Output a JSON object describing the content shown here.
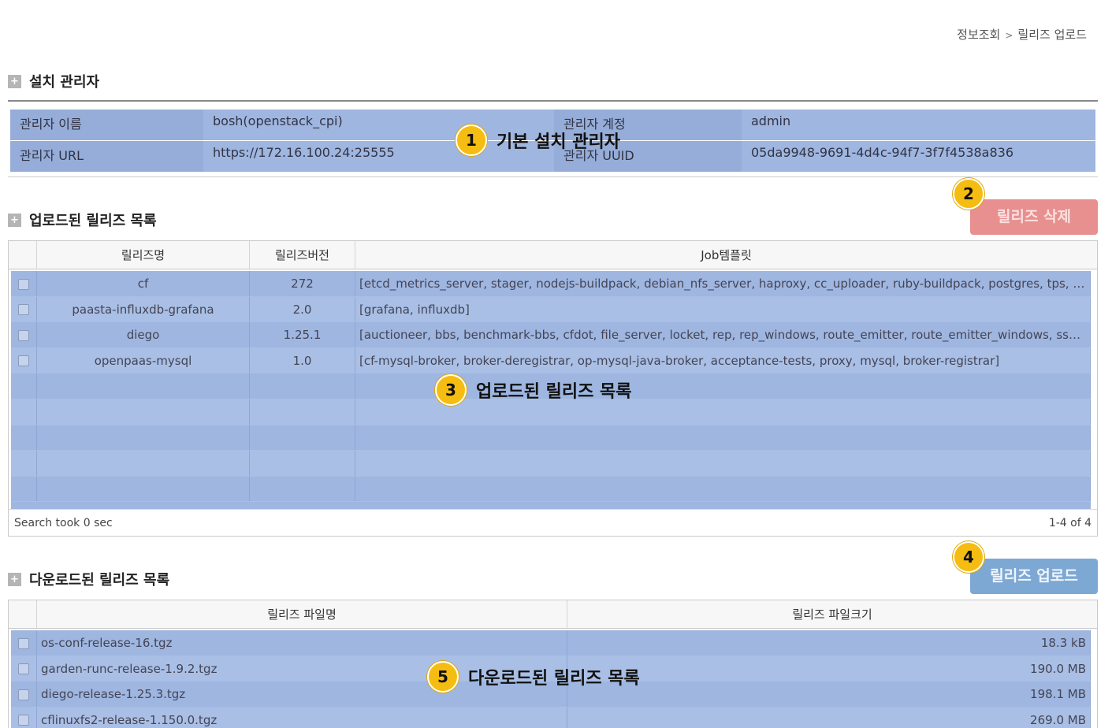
{
  "breadcrumb": {
    "parent": "정보조회",
    "separator": ">",
    "current": "릴리즈 업로드"
  },
  "installer": {
    "title": "설치 관리자",
    "name_label": "관리자 이름",
    "name_value": "bosh(openstack_cpi)",
    "account_label": "관리자 계정",
    "account_value": "admin",
    "url_label": "관리자 URL",
    "url_value": "https://172.16.100.24:25555",
    "uuid_label": "관리자 UUID",
    "uuid_value": "05da9948-9691-4d4c-94f7-3f7f4538a836"
  },
  "uploaded": {
    "title": "업로드된 릴리즈 목록",
    "delete_button": "릴리즈 삭제",
    "columns": [
      "릴리즈명",
      "릴리즈버전",
      "Job템플릿"
    ],
    "rows": [
      {
        "name": "cf",
        "version": "272",
        "jobs": "[etcd_metrics_server, stager, nodejs-buildpack, debian_nfs_server, haproxy, cc_uploader, ruby-buildpack, postgres, tps, nats, garden]"
      },
      {
        "name": "paasta-influxdb-grafana",
        "version": "2.0",
        "jobs": "[grafana, influxdb]"
      },
      {
        "name": "diego",
        "version": "1.25.1",
        "jobs": "[auctioneer, bbs, benchmark-bbs, cfdot, file_server, locket, rep, rep_windows, route_emitter, route_emitter_windows, ssh_proxy]"
      },
      {
        "name": "openpaas-mysql",
        "version": "1.0",
        "jobs": "[cf-mysql-broker, broker-deregistrar, op-mysql-java-broker, acceptance-tests, proxy, mysql, broker-registrar]"
      }
    ],
    "footer_left": "Search took 0 sec",
    "footer_right": "1-4 of 4"
  },
  "downloaded": {
    "title": "다운로드된 릴리즈 목록",
    "upload_button": "릴리즈 업로드",
    "columns": [
      "릴리즈 파일명",
      "릴리즈 파일크기"
    ],
    "rows": [
      {
        "file": "os-conf-release-16.tgz",
        "size": "18.3 kB"
      },
      {
        "file": "garden-runc-release-1.9.2.tgz",
        "size": "190.0 MB"
      },
      {
        "file": "diego-release-1.25.3.tgz",
        "size": "198.1 MB"
      },
      {
        "file": "cflinuxfs2-release-1.150.0.tgz",
        "size": "269.0 MB"
      }
    ]
  },
  "callouts": [
    {
      "number": "1",
      "text": "기본 설치 관리자"
    },
    {
      "number": "2",
      "text": ""
    },
    {
      "number": "3",
      "text": "업로드된 릴리즈 목록"
    },
    {
      "number": "4",
      "text": ""
    },
    {
      "number": "5",
      "text": "다운로드된 릴리즈 목록"
    }
  ],
  "icons": {
    "section": "plus-icon"
  },
  "colors": {
    "highlight": "#9eb6e0",
    "delete_button": "#e88f8f",
    "upload_button": "#7ea8d4",
    "badge": "#f5bd12"
  }
}
